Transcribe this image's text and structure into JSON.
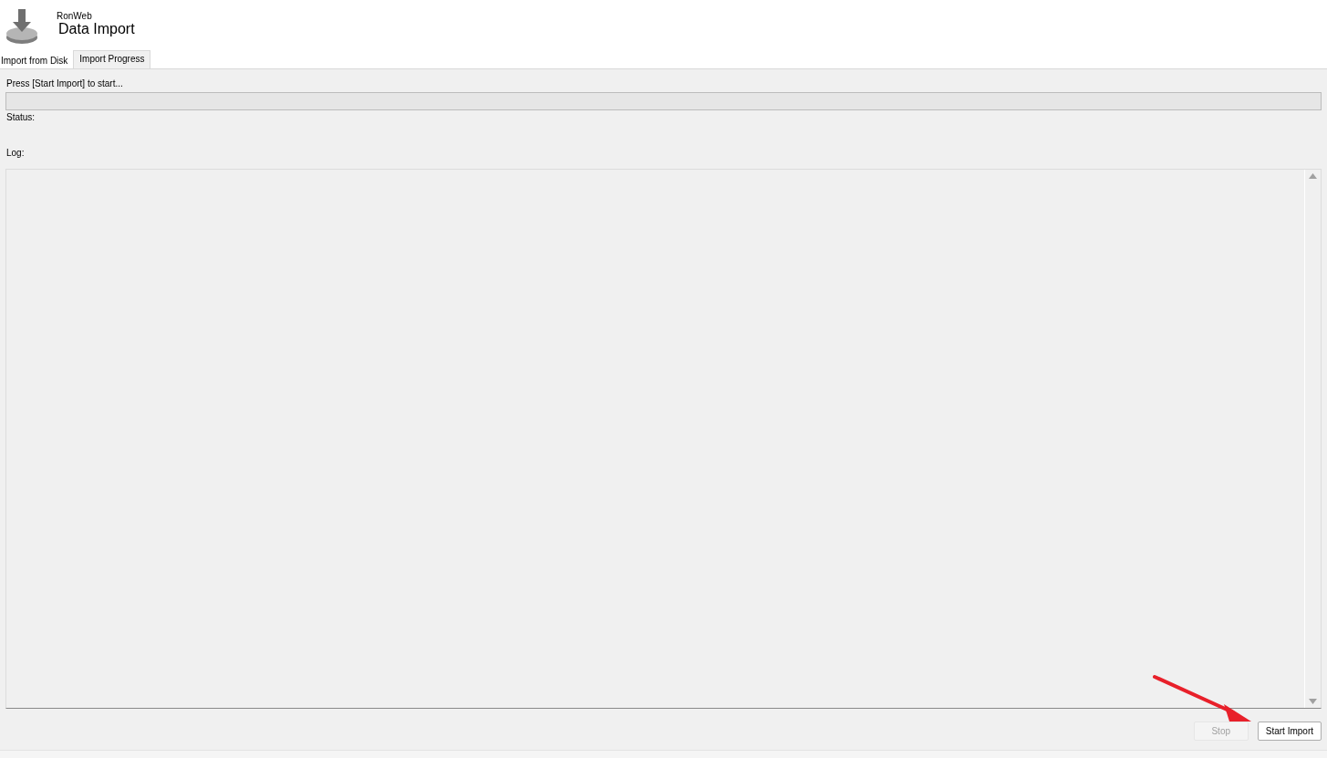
{
  "header": {
    "app_name": "RonWeb",
    "title": "Data Import"
  },
  "tabs": [
    {
      "label": "Import from Disk",
      "selected": false
    },
    {
      "label": "Import Progress",
      "selected": true
    }
  ],
  "progress": {
    "message": "Press [Start Import] to start...",
    "level": 0
  },
  "status": {
    "label": "Status:"
  },
  "log": {
    "label": "Log:"
  },
  "buttons": [
    {
      "label": "Stop",
      "disabled": true
    },
    {
      "label": "Start Import",
      "disabled": false
    }
  ],
  "annotation": {
    "kind": "arrow"
  }
}
